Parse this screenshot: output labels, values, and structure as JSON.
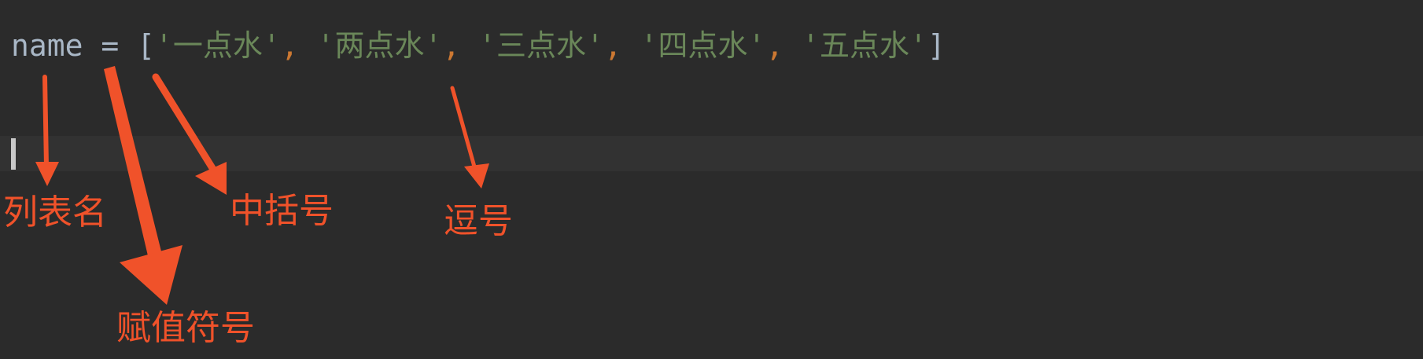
{
  "code": {
    "identifier": "name",
    "assign": " = ",
    "open_bracket": "[",
    "close_bracket": "]",
    "separator": ", ",
    "items": [
      "'一点水'",
      "'两点水'",
      "'三点水'",
      "'四点水'",
      "'五点水'"
    ]
  },
  "annotations": {
    "list_name": "列表名",
    "brackets": "中括号",
    "comma": "逗号",
    "assignment": "赋值符号"
  },
  "colors": {
    "background": "#2b2b2b",
    "identifier": "#a9b7c6",
    "string": "#6a8759",
    "comma": "#cc7832",
    "annotation": "#f0522a"
  }
}
